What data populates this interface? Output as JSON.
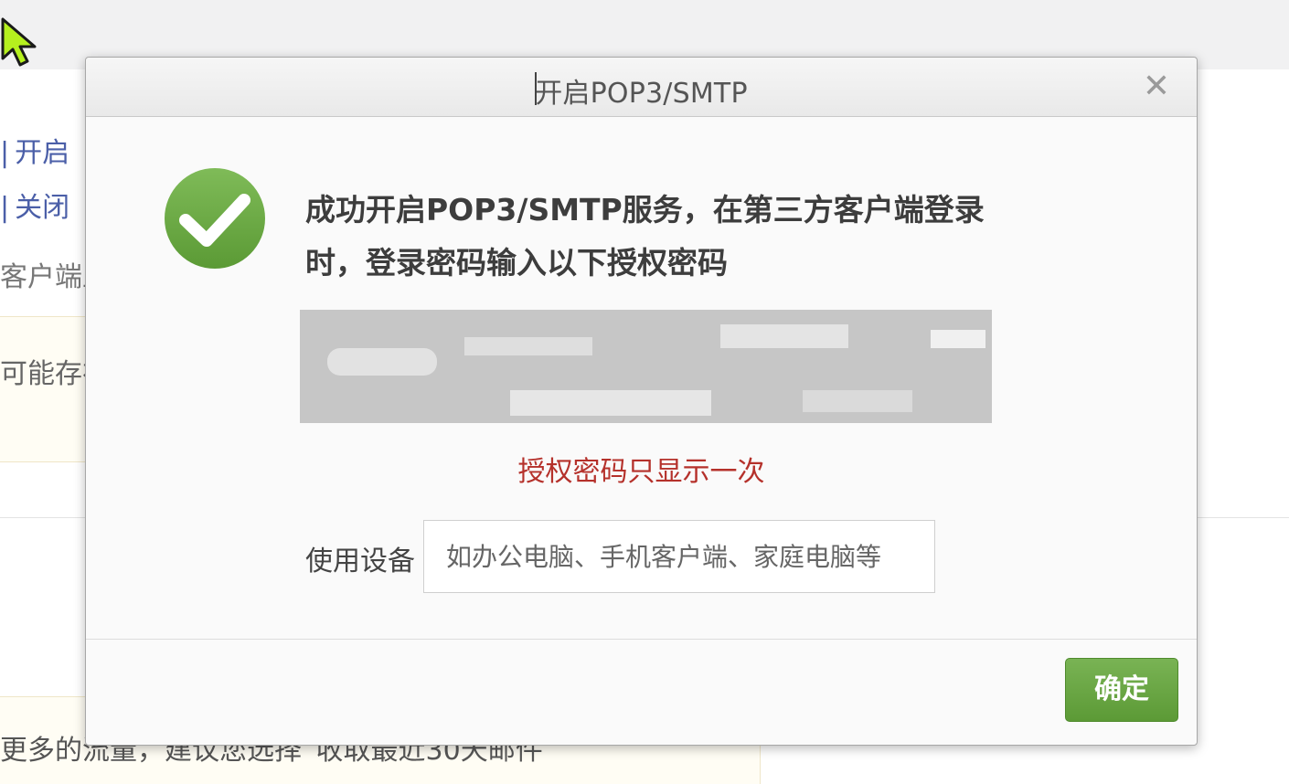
{
  "background": {
    "link_open": "开启",
    "link_close": "关闭",
    "separator": "|",
    "text_client": "客户端上",
    "text_warning": "可能存在",
    "text_bottom": "更多的流量，建议您选择“收取最近30天邮件"
  },
  "dialog": {
    "title": "开启POP3/SMTP",
    "close_icon": "close-icon",
    "success_icon": "checkmark-circle-icon",
    "success_message": "成功开启POP3/SMTP服务，在第三方客户端登录时，登录密码输入以下授权密码",
    "password_notice": "授权密码只显示一次",
    "device_label": "使用设备",
    "device_placeholder": "如办公电脑、手机客户端、家庭电脑等",
    "confirm_label": "确定"
  },
  "colors": {
    "link": "#4b5fa8",
    "notice": "#b5312b",
    "success_green": "#6aa943",
    "button_green": "#68a544"
  }
}
